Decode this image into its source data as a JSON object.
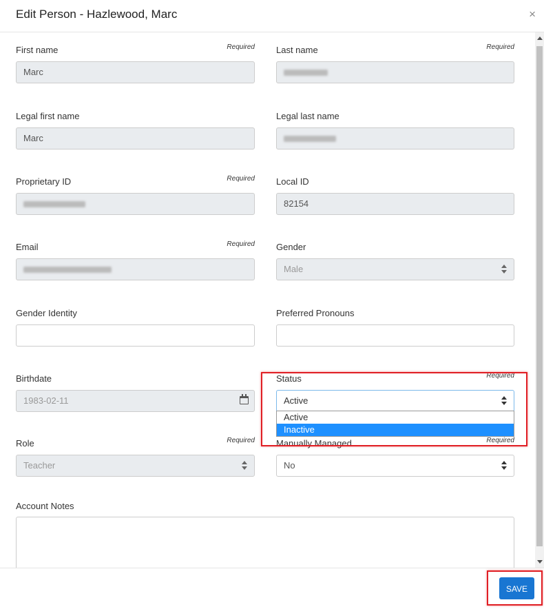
{
  "header": {
    "title": "Edit Person - Hazlewood, Marc",
    "close_label": "×"
  },
  "required_label": "Required",
  "fields": {
    "first_name": {
      "label": "First name",
      "value": "Marc"
    },
    "last_name": {
      "label": "Last name"
    },
    "legal_first_name": {
      "label": "Legal first name",
      "value": "Marc"
    },
    "legal_last_name": {
      "label": "Legal last name"
    },
    "proprietary_id": {
      "label": "Proprietary ID"
    },
    "local_id": {
      "label": "Local ID",
      "value": "82154"
    },
    "email": {
      "label": "Email"
    },
    "gender": {
      "label": "Gender",
      "value": "Male"
    },
    "gender_identity": {
      "label": "Gender Identity",
      "value": ""
    },
    "preferred_pronouns": {
      "label": "Preferred Pronouns",
      "value": ""
    },
    "birthdate": {
      "label": "Birthdate",
      "value": "1983-02-11"
    },
    "status": {
      "label": "Status",
      "value": "Active",
      "options": [
        "Active",
        "Inactive"
      ]
    },
    "role": {
      "label": "Role",
      "value": "Teacher"
    },
    "manually_managed": {
      "label": "Manually Managed",
      "value": "No"
    },
    "account_notes": {
      "label": "Account Notes",
      "value": ""
    }
  },
  "footer": {
    "save_label": "SAVE"
  },
  "colors": {
    "accent": "#1976d2",
    "highlight": "#1e90ff",
    "annotation": "#e01e24"
  }
}
